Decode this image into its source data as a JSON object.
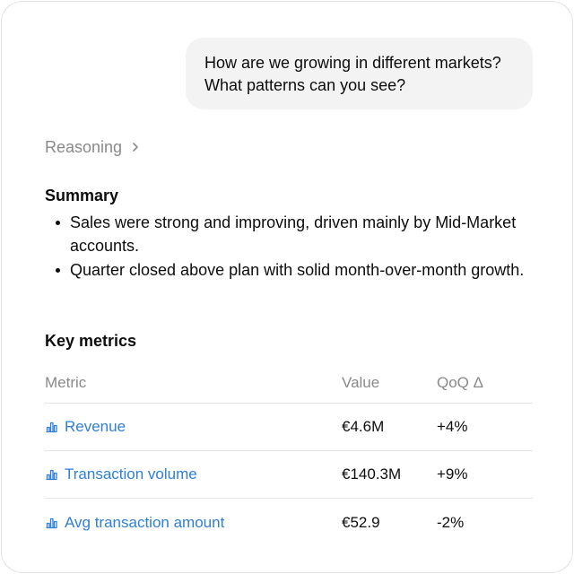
{
  "conversation": {
    "user_message_lines": [
      "How are we growing in different markets?",
      "What patterns can you see?"
    ]
  },
  "reasoning": {
    "label": "Reasoning",
    "icon": "chevron-right-icon"
  },
  "summary": {
    "heading": "Summary",
    "bullets": [
      "Sales were strong and improving, driven mainly by Mid-Market accounts.",
      "Quarter closed above plan with solid month-over-month growth."
    ]
  },
  "metrics": {
    "heading": "Key metrics",
    "columns": [
      "Metric",
      "Value",
      "QoQ Δ"
    ],
    "rows": [
      {
        "metric": "Revenue",
        "value": "€4.6M",
        "delta": "+4%",
        "icon": "bar-chart-icon"
      },
      {
        "metric": "Transaction volume",
        "value": "€140.3M",
        "delta": "+9%",
        "icon": "bar-chart-icon"
      },
      {
        "metric": "Avg transaction amount",
        "value": "€52.9",
        "delta": "-2%",
        "icon": "bar-chart-icon"
      }
    ]
  },
  "colors": {
    "link": "#2f7fd6",
    "muted": "#8a8a8a",
    "bubble": "#f3f3f3",
    "border": "#e3e3e3"
  }
}
